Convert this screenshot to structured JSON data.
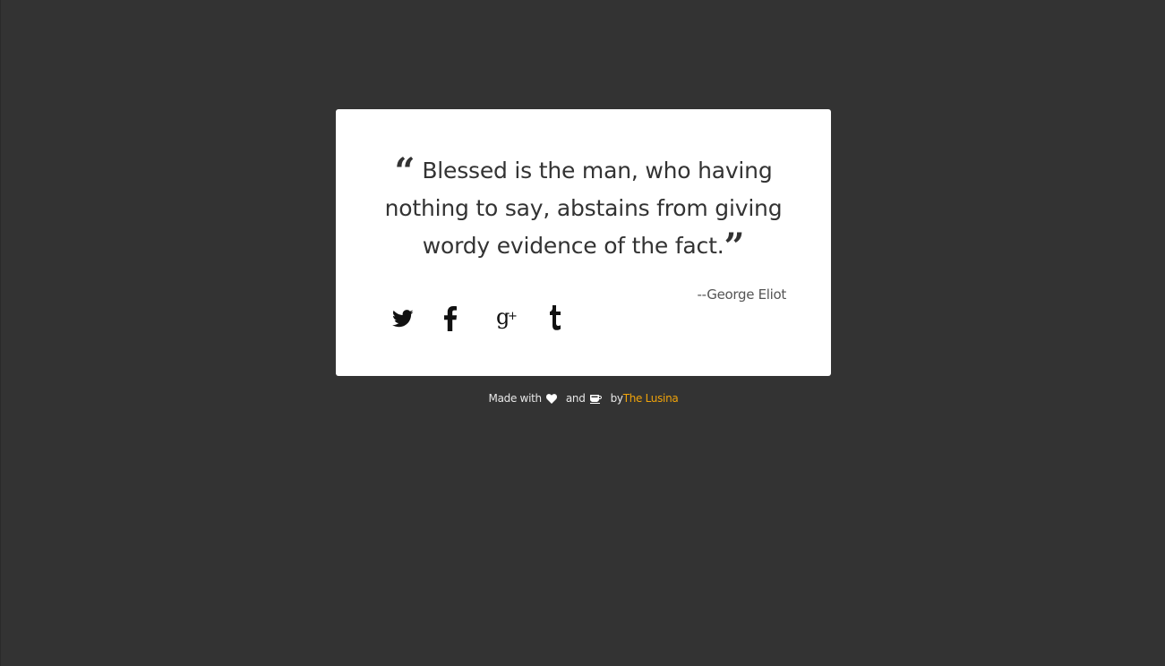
{
  "quote": {
    "text": "Blessed is the man, who having nothing to say, abstains from giving wordy evidence of the fact.",
    "author": "--George Eliot"
  },
  "social": {
    "icons": [
      "twitter-icon",
      "facebook-icon",
      "google-plus-icon",
      "tumblr-icon"
    ]
  },
  "footer": {
    "made_with": "Made with",
    "and": "and",
    "by": "by",
    "author_link": "The Lusina"
  },
  "colors": {
    "background": "#333333",
    "card": "#ffffff",
    "link": "#f0a30a",
    "text": "#333333"
  }
}
